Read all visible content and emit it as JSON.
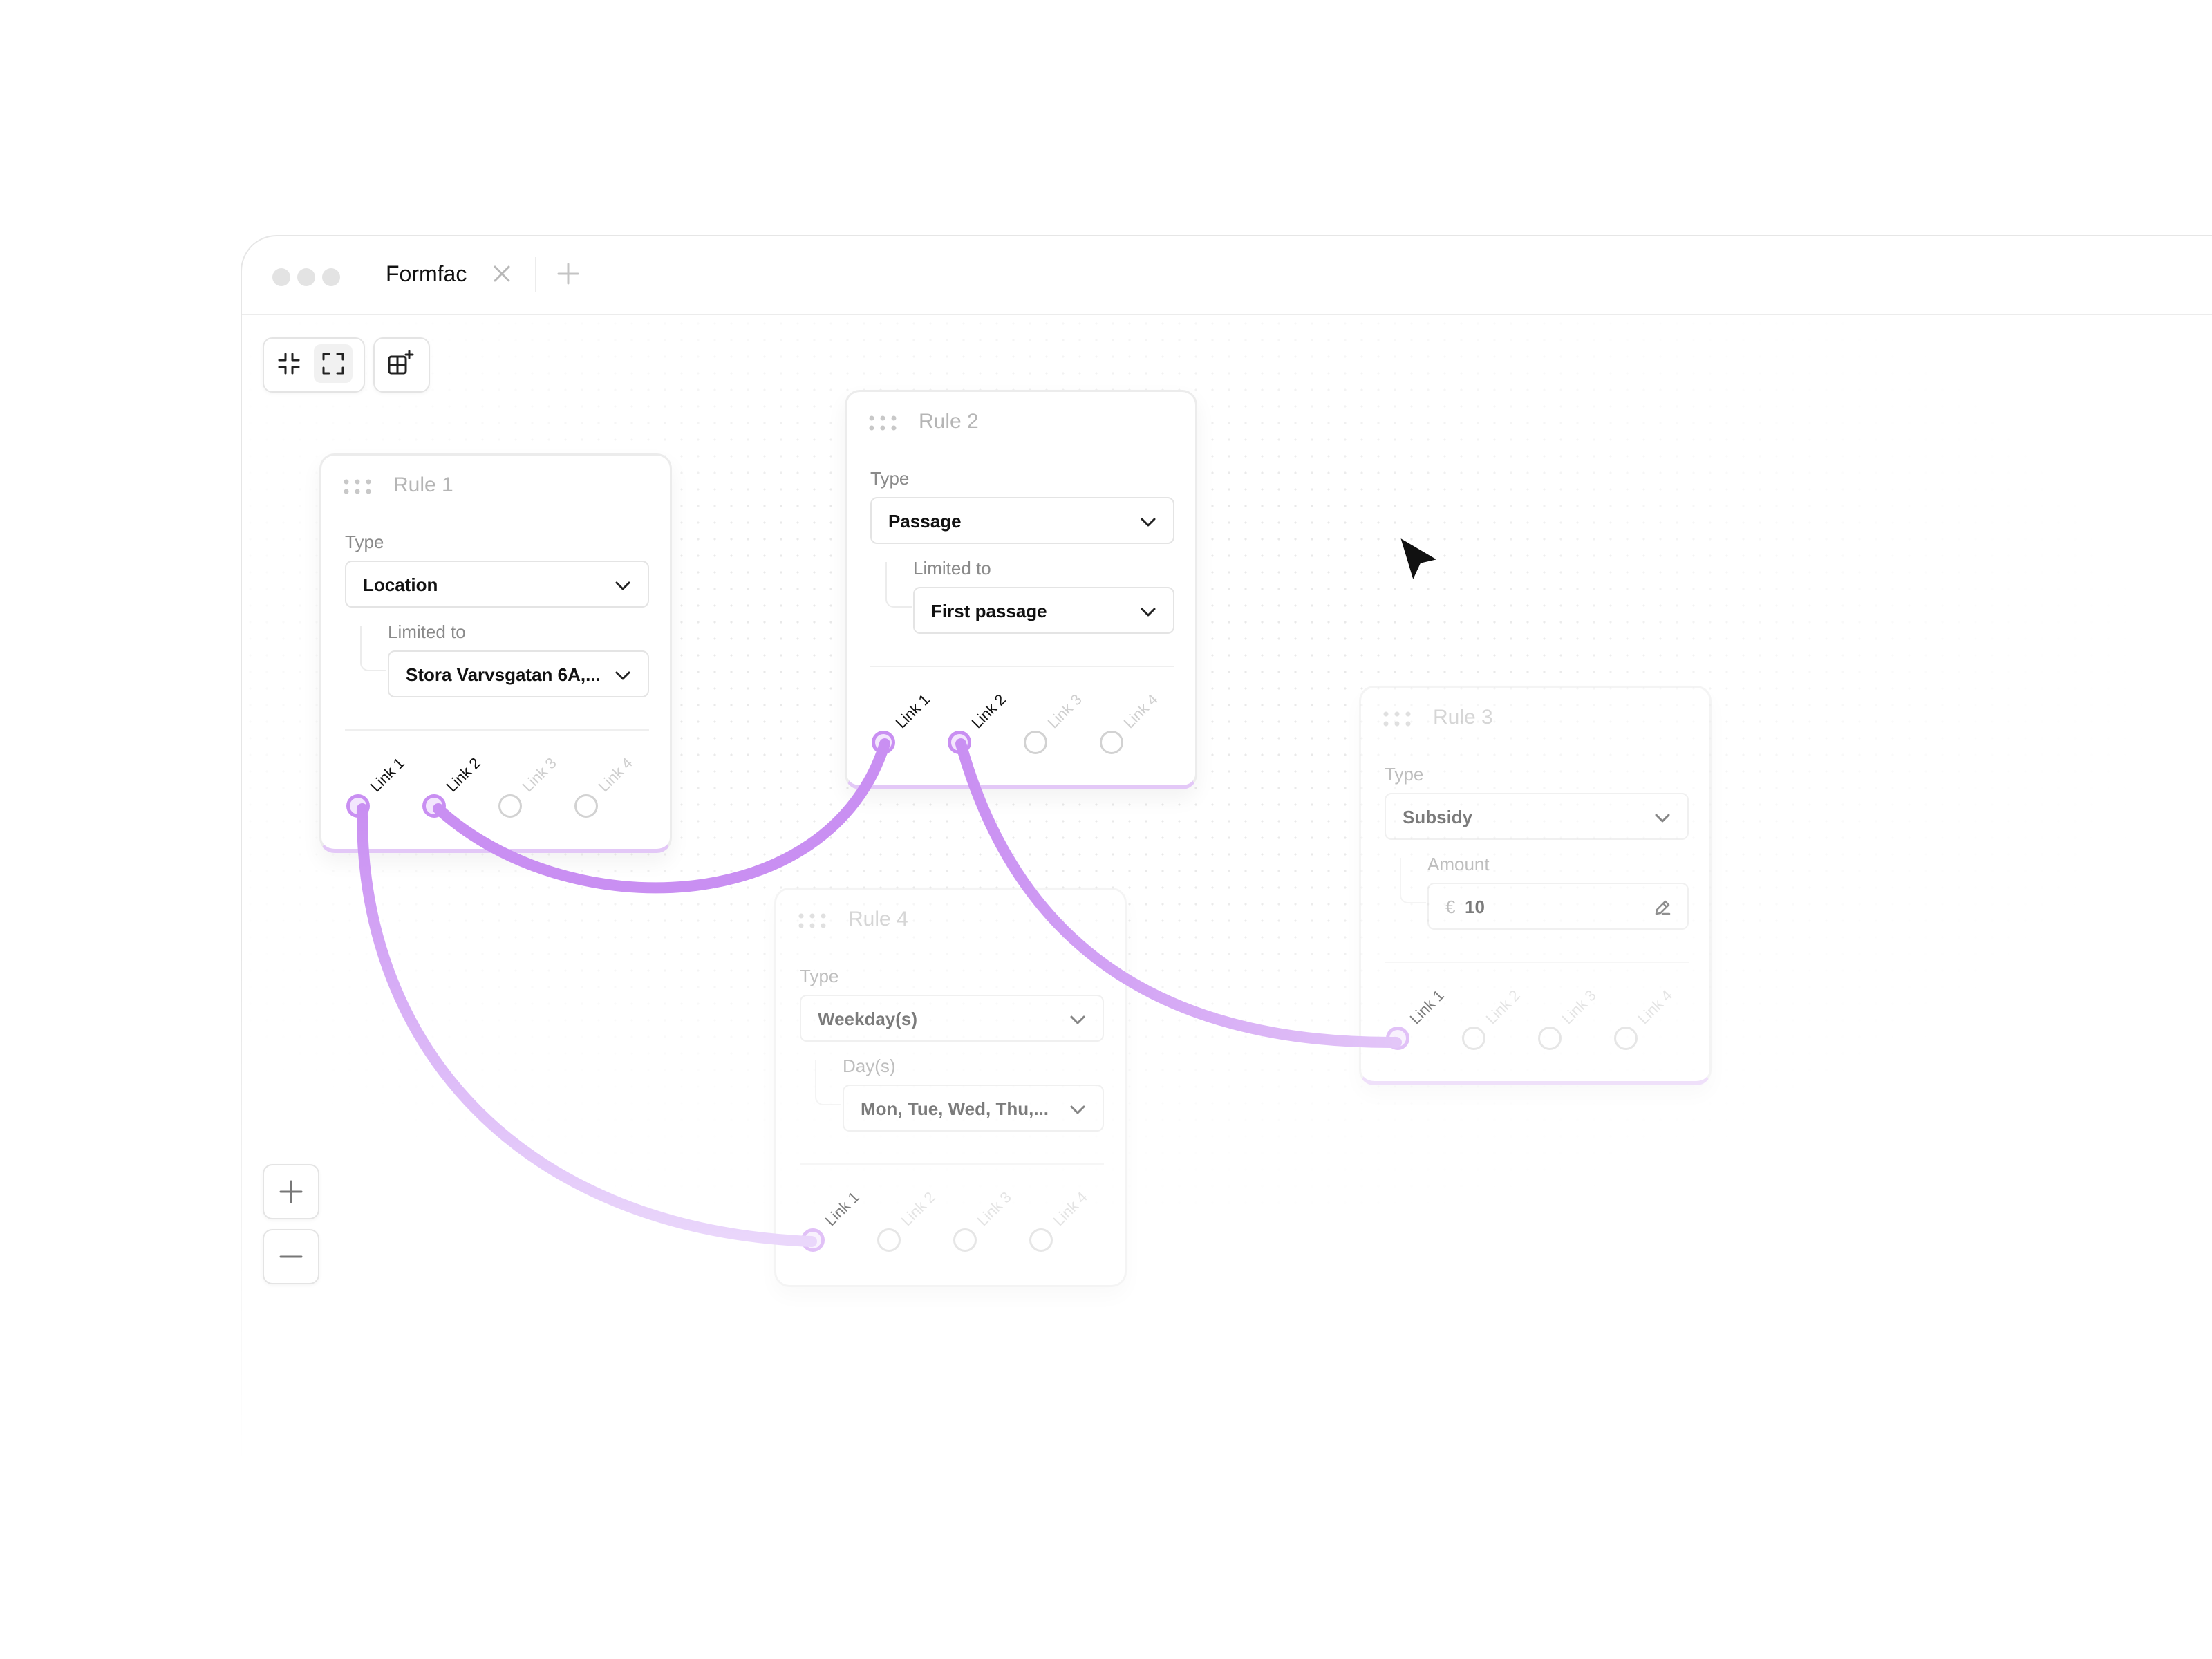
{
  "window": {
    "tab_title": "Formfac",
    "colors": {
      "accent": "#c98ff2",
      "accent_soft": "#e3c8f7",
      "border": "#e4e4e4"
    }
  },
  "toolbar": {
    "icons": [
      "collapse-icon",
      "expand-icon",
      "add-node-icon"
    ]
  },
  "zoom": {
    "icons": [
      "plus-icon",
      "minus-icon"
    ]
  },
  "nodes": {
    "rule1": {
      "title": "Rule 1",
      "type_label": "Type",
      "type_value": "Location",
      "sub_label": "Limited to",
      "sub_value": "Stora Varvsgatan 6A,...",
      "links": [
        "Link 1",
        "Link 2",
        "Link 3",
        "Link 4"
      ]
    },
    "rule2": {
      "title": "Rule 2",
      "type_label": "Type",
      "type_value": "Passage",
      "sub_label": "Limited to",
      "sub_value": "First passage",
      "links": [
        "Link 1",
        "Link 2",
        "Link 3",
        "Link 4"
      ]
    },
    "rule3": {
      "title": "Rule 3",
      "type_label": "Type",
      "type_value": "Subsidy",
      "sub_label": "Amount",
      "currency": "€",
      "amount": "10",
      "links": [
        "Link 1",
        "Link 2",
        "Link 3",
        "Link 4"
      ]
    },
    "rule4": {
      "title": "Rule 4",
      "type_label": "Type",
      "type_value": "Weekday(s)",
      "sub_label": "Day(s)",
      "sub_value": "Mon, Tue, Wed, Thu,...",
      "links": [
        "Link 1",
        "Link 2",
        "Link 3",
        "Link 4"
      ]
    }
  }
}
